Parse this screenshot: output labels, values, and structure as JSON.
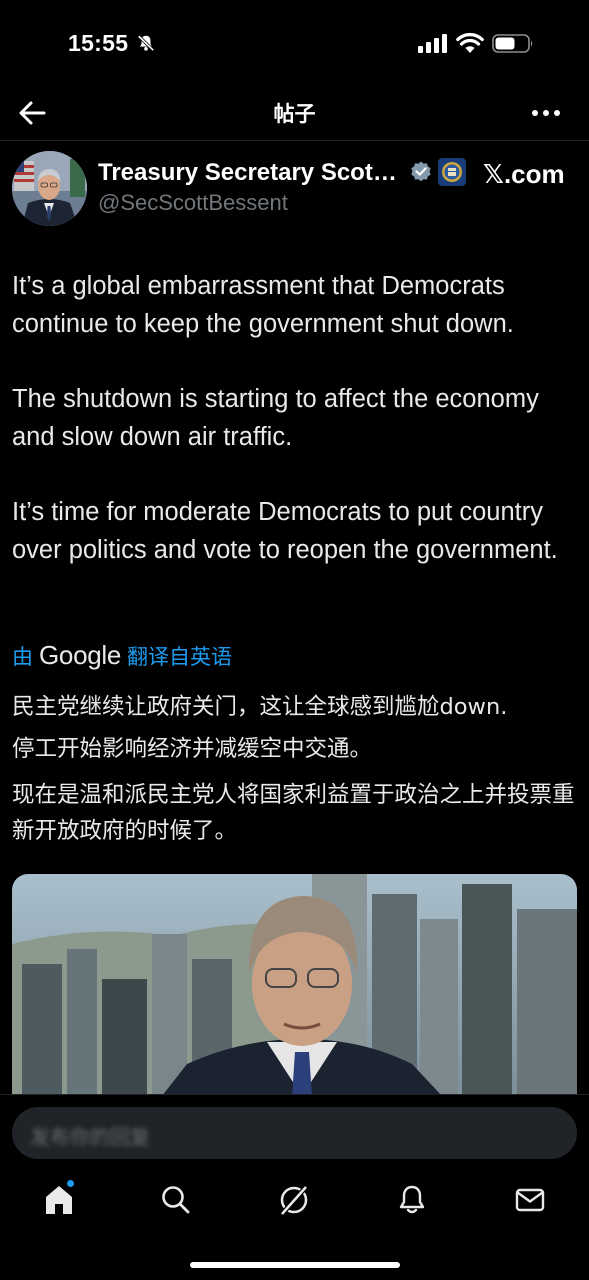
{
  "status_bar": {
    "time": "15:55"
  },
  "header": {
    "title": "帖子"
  },
  "author": {
    "name": "Treasury Secretary Scot…",
    "handle": "@SecScottBessent",
    "source_badge": "𝕏.com"
  },
  "tweet": {
    "paragraphs": [
      "It’s a global embarrassment that Democrats continue to keep the government shut down.",
      "The shutdown is starting to affect the economy and slow down air traffic.",
      "It’s time for moderate Democrats to put country over politics and vote to reopen the government."
    ]
  },
  "translation": {
    "prefix": "由",
    "brand": "Google",
    "suffix": "翻译自英语",
    "lines": [
      "民主党继续让政府关门，这让全球感到尴尬down.",
      "停工开始影响经济并减缓空中交通。",
      "现在是温和派民主党人将国家利益置于政治之上并投票重新开放政府的时候了。"
    ]
  },
  "reply": {
    "placeholder": "发布你的回复"
  },
  "colors": {
    "accent": "#1d9bf0",
    "background": "#000000",
    "text": "#e7e9ea",
    "secondary": "#71767b"
  },
  "icons": {
    "status": [
      "bell-off-icon",
      "signal-icon",
      "wifi-icon",
      "battery-icon"
    ],
    "nav": [
      "home-icon",
      "search-icon",
      "grok-icon",
      "notifications-icon",
      "messages-icon"
    ]
  }
}
